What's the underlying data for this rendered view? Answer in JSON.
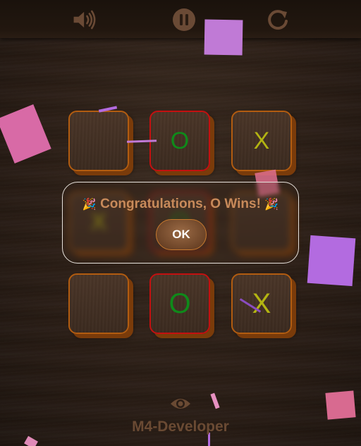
{
  "toolbar": {
    "sound_icon": "speaker-icon",
    "pause_icon": "pause-icon",
    "restart_icon": "restart-icon"
  },
  "board": {
    "cells": [
      "",
      "O",
      "X",
      "X",
      "O",
      "",
      "",
      "O",
      "X"
    ],
    "winning_cells": [
      1,
      4,
      7
    ]
  },
  "dialog": {
    "message": "Congratulations, O Wins!",
    "left_icon": "party-popper-icon",
    "right_icon": "party-popper-icon",
    "ok_label": "OK"
  },
  "footer": {
    "icon": "eye-icon",
    "label": "M4-Developer"
  },
  "colors": {
    "o_mark": "#0f8a1a",
    "x_mark": "#b3b412",
    "win_border": "#c41010",
    "cell_border": "#b25c10",
    "confetti_pink": "#d86aa6",
    "confetti_purple": "#b36be0"
  }
}
